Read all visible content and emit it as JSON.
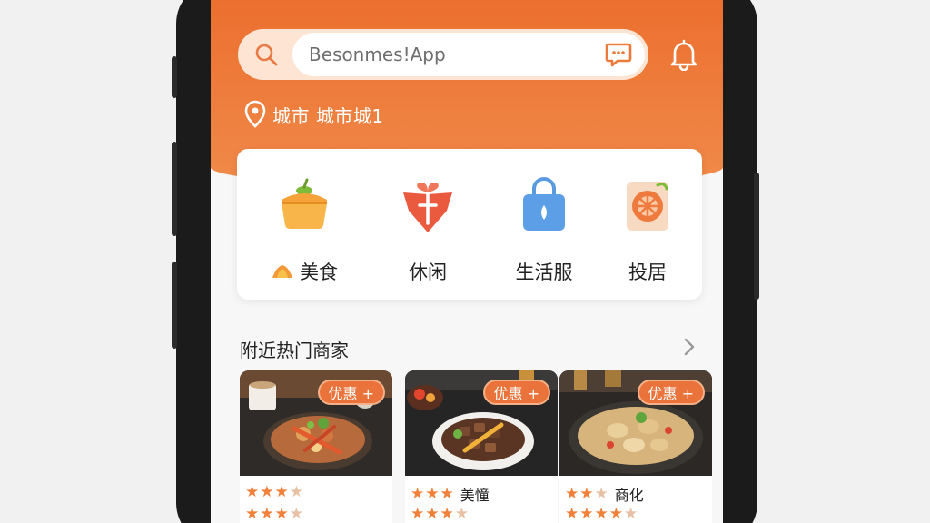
{
  "search": {
    "placeholder": "Besonmes!App"
  },
  "location": {
    "text": "城市 城市城1"
  },
  "categories": [
    {
      "label": "美食",
      "icon": "food-basket-icon"
    },
    {
      "label": "休闲",
      "icon": "gift-icon"
    },
    {
      "label": "生活服",
      "icon": "shopping-bag-icon"
    },
    {
      "label": "投居",
      "icon": "orange-card-icon"
    }
  ],
  "section": {
    "title": "附近热门商家"
  },
  "shops": [
    {
      "badge": "优惠 +",
      "row1_stars": "★★★",
      "row1_dim": "★",
      "row1_name": "",
      "row2_stars": "★★★",
      "row2_dim": "★",
      "row2_meta": ""
    },
    {
      "badge": "优惠 +",
      "row1_stars": "★★★",
      "row1_dim": "",
      "row1_name": "美憧",
      "row2_stars": "★★★",
      "row2_dim": "★",
      "row2_meta": ""
    },
    {
      "badge": "优惠 +",
      "row1_stars": "★★",
      "row1_dim": "★",
      "row1_name": "商化",
      "row2_stars": "★★★★",
      "row2_dim": "★",
      "row2_meta": ""
    }
  ],
  "colors": {
    "brand": "#ec6f2f",
    "badge": "#e9733a",
    "star": "#f0803a"
  }
}
